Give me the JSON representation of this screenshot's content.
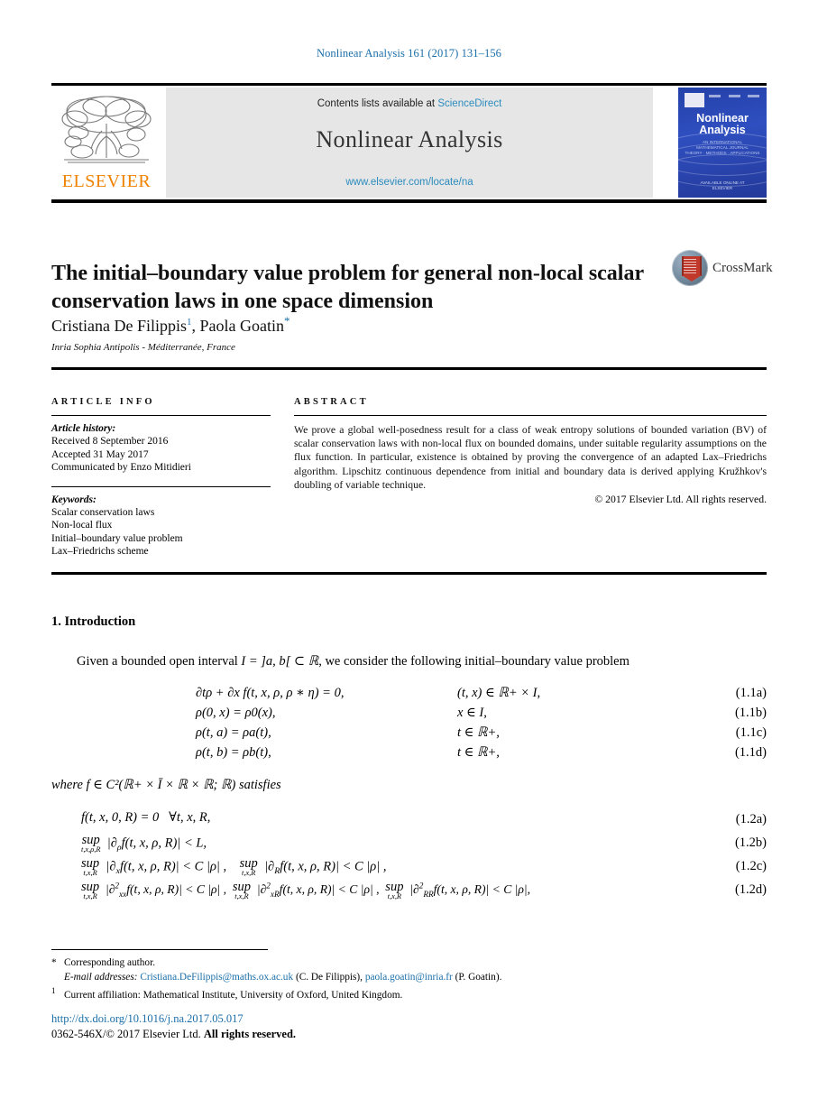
{
  "running_head": "Nonlinear Analysis 161 (2017) 131–156",
  "banner": {
    "contents_prefix": "Contents lists available at ",
    "sciencedirect": "ScienceDirect",
    "journal_name": "Nonlinear Analysis",
    "journal_url": "www.elsevier.com/locate/na",
    "publisher_wordmark": "ELSEVIER",
    "cover": {
      "title_line1": "Nonlinear",
      "title_line2": "Analysis",
      "subtitle_line1": "AN INTERNATIONAL",
      "subtitle_line2": "MATHEMATICAL JOURNAL",
      "subtitle_line3": "THEORY · METHODS · APPLICATIONS",
      "footer_line1": "AVAILABLE ONLINE AT",
      "footer_line2": "ELSEVIER"
    }
  },
  "article": {
    "title": "The initial–boundary value problem for general non-local scalar conservation laws in one space dimension",
    "authors_part1": "Cristiana De Filippis",
    "author1_footnote": "1",
    "authors_part2": ", Paola Goatin",
    "author2_footnote": "*",
    "affiliation": "Inria Sophia Antipolis - Méditerranée, France",
    "crossmark_label": "CrossMark"
  },
  "article_info": {
    "heading": "ARTICLE INFO",
    "history_label": "Article history:",
    "history": [
      "Received 8 September 2016",
      "Accepted 31 May 2017",
      "Communicated by Enzo Mitidieri"
    ],
    "keywords_label": "Keywords:",
    "keywords": [
      "Scalar conservation laws",
      "Non-local flux",
      "Initial–boundary value problem",
      "Lax–Friedrichs scheme"
    ]
  },
  "abstract": {
    "heading": "ABSTRACT",
    "text": "We prove a global well-posedness result for a class of weak entropy solutions of bounded variation (BV) of scalar conservation laws with non-local flux on bounded domains, under suitable regularity assumptions on the flux function. In particular, existence is obtained by proving the convergence of an adapted Lax–Friedrichs algorithm. Lipschitz continuous dependence from initial and boundary data is derived applying Kružhkov's doubling of variable technique.",
    "copyright": "© 2017 Elsevier Ltd. All rights reserved."
  },
  "body": {
    "section_title": "1. Introduction",
    "intro_paragraph_prefix": "Given a bounded open interval ",
    "intro_paragraph_math": "I = ]a, b[ ⊂ ℝ",
    "intro_paragraph_suffix": ", we consider the following initial–boundary value problem",
    "equations_11": [
      {
        "lhs": "∂tρ + ∂x f(t, x, ρ, ρ ∗ η) = 0,",
        "cond": "(t, x) ∈ ℝ+ × I,",
        "tag": "(1.1a)"
      },
      {
        "lhs": "ρ(0, x) = ρ0(x),",
        "cond": "x ∈ I,",
        "tag": "(1.1b)"
      },
      {
        "lhs": "ρ(t, a) = ρa(t),",
        "cond": "t ∈ ℝ+,",
        "tag": "(1.1c)"
      },
      {
        "lhs": "ρ(t, b) = ρb(t),",
        "cond": "t ∈ ℝ+,",
        "tag": "(1.1d)"
      }
    ],
    "where_line": "where f ∈ C²(ℝ+ × Ī × ℝ × ℝ; ℝ) satisfies",
    "equations_12": [
      {
        "tag": "(1.2a)"
      },
      {
        "tag": "(1.2b)"
      },
      {
        "tag": "(1.2c)"
      },
      {
        "tag": "(1.2d)"
      }
    ]
  },
  "footnotes": {
    "corresponding": "Corresponding author.",
    "corresponding_mark": "*",
    "email_label": "E-mail addresses:",
    "email1": "Cristiana.DeFilippis@maths.ox.ac.uk",
    "email1_owner": "(C. De Filippis),",
    "email2": "paola.goatin@inria.fr",
    "email2_owner": "(P. Goatin).",
    "affiliation_mark": "1",
    "affiliation_note": "Current affiliation: Mathematical Institute, University of Oxford, United Kingdom."
  },
  "footer": {
    "doi": "http://dx.doi.org/10.1016/j.na.2017.05.017",
    "issn_prefix": "0362-546X/© 2017 Elsevier Ltd. ",
    "issn_bold": "All rights reserved."
  },
  "colors": {
    "link": "#1a6ea8",
    "elsevier_orange": "#ef8200",
    "banner_gray": "#e6e6e6",
    "cover_blue": "#2440a8"
  }
}
